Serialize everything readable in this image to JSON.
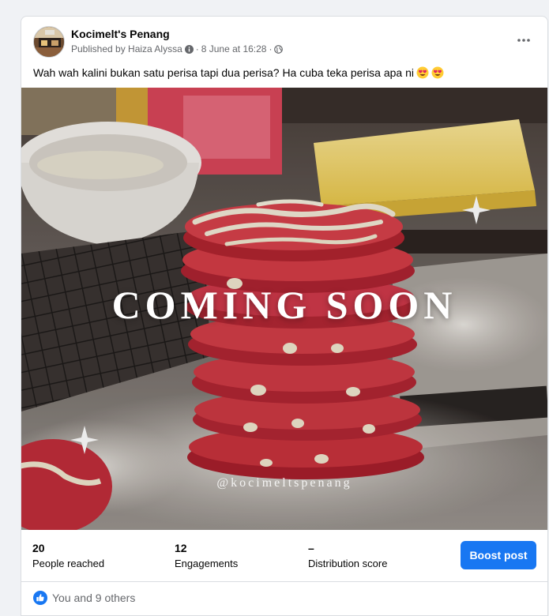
{
  "post": {
    "page_name": "Kocimelt's Penang",
    "published_by": "Published by Haiza Alyssa",
    "timestamp": "8 June at 16:28",
    "separator": "·",
    "audience_icon": "globe-icon",
    "caption": "Wah wah kalini bukan satu perisa tapi dua perisa? Ha cuba teka perisa apa ni",
    "caption_emoji": "heart-eyes-emoji",
    "image": {
      "headline": "COMING SOON",
      "handle": "@kocimeltspenang"
    }
  },
  "insights": {
    "people_reached_value": "20",
    "people_reached_label": "People reached",
    "engagements_value": "12",
    "engagements_label": "Engagements",
    "distribution_value": "–",
    "distribution_label": "Distribution score",
    "boost_label": "Boost post"
  },
  "reactions": {
    "text": "You and 9 others",
    "icon": "like-icon"
  },
  "colors": {
    "accent": "#1877f2",
    "secondary_text": "#65676b",
    "cookie_red": "#c8323c"
  }
}
